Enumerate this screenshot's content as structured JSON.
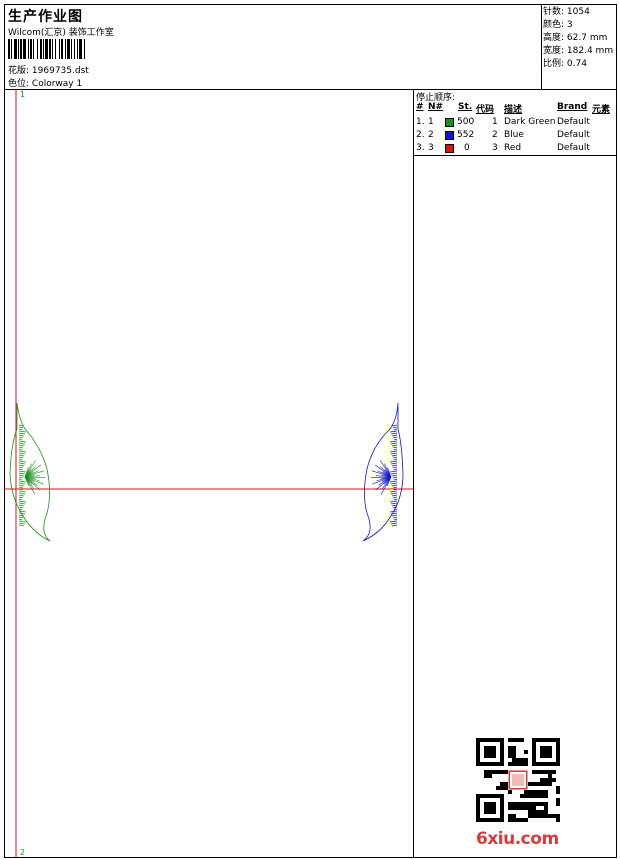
{
  "header": {
    "title": "生产作业图",
    "company": "Wilcom(汇京) 装饰工作室",
    "design_label": "花版:",
    "design_value": "1969735.dst",
    "colorway_label": "色位:",
    "colorway_value": "Colorway 1"
  },
  "stats": {
    "stitches_label": "针数:",
    "stitches_value": "1054",
    "colors_label": "颜色:",
    "colors_value": "3",
    "height_label": "高度:",
    "height_value": "62.7 mm",
    "width_label": "宽度:",
    "width_value": "182.4 mm",
    "scale_label": "比例:",
    "scale_value": "0.74"
  },
  "canvas": {
    "marker_top": "1",
    "marker_bottom": "2"
  },
  "sequence": {
    "title": "停止顺序:",
    "headers": {
      "index": "#",
      "no": "N#",
      "stitches": "St.",
      "code": "代码",
      "description": "描述",
      "brand": "Brand",
      "element": "元素"
    },
    "rows": [
      {
        "index": "1.",
        "no": "1",
        "color": "#1a8f1a",
        "stitches": "500",
        "code": "1",
        "description": "Dark Green",
        "brand": "Default"
      },
      {
        "index": "2.",
        "no": "2",
        "color": "#1010e0",
        "stitches": "552",
        "code": "2",
        "description": "Blue",
        "brand": "Default"
      },
      {
        "index": "3.",
        "no": "3",
        "color": "#e01010",
        "stitches": "0",
        "code": "3",
        "description": "Red",
        "brand": "Default"
      }
    ]
  },
  "colors": {
    "guide": "#e01010",
    "green": "#1a8f1a",
    "blue": "#1010e0"
  },
  "watermark": {
    "text": "6xiu.com"
  }
}
